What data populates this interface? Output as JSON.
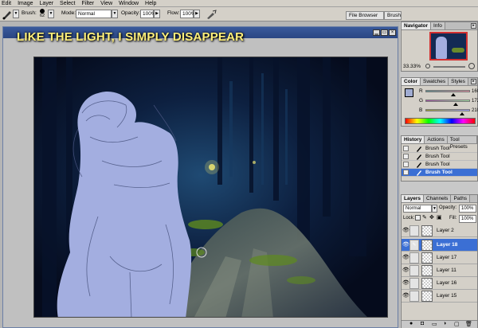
{
  "menu": [
    "Edit",
    "Image",
    "Layer",
    "Select",
    "Filter",
    "View",
    "Window",
    "Help"
  ],
  "options": {
    "brush_label": "Brush:",
    "brush_size": "62",
    "mode_label": "Mode:",
    "mode_value": "Normal",
    "opacity_label": "Opacity:",
    "opacity_value": "100%",
    "flow_label": "Flow:",
    "flow_value": "100%",
    "tabs": [
      "File Browser",
      "Brushe"
    ]
  },
  "caption": "LIKE THE LIGHT, I SIMPLY DISAPPEAR",
  "navigator": {
    "tabs": [
      "Navigator",
      "Info"
    ],
    "zoom": "33.33%"
  },
  "color": {
    "tabs": [
      "Color",
      "Swatches",
      "Styles"
    ],
    "channels": [
      {
        "label": "R",
        "value": "160",
        "fraction": 0.63,
        "gradient": "#5a8f8f,#e08fa0"
      },
      {
        "label": "G",
        "value": "172",
        "fraction": 0.67,
        "gradient": "#a050a0,#a0e0a0"
      },
      {
        "label": "B",
        "value": "210",
        "fraction": 0.82,
        "gradient": "#a0a030,#a0a0ff"
      }
    ],
    "foreground": "#a0acd2",
    "background": "#f2e84a"
  },
  "history": {
    "tabs": [
      "History",
      "Actions",
      "Tool Presets"
    ],
    "items": [
      "Brush Tool",
      "Brush Tool",
      "Brush Tool",
      "Brush Tool"
    ],
    "selected_index": 3
  },
  "layers": {
    "tabs": [
      "Layers",
      "Channels",
      "Paths"
    ],
    "blend_mode": "Normal",
    "opacity_label": "Opacity:",
    "opacity_value": "100%",
    "lock_label": "Lock:",
    "fill_label": "Fill:",
    "fill_value": "100%",
    "items": [
      "Layer 2",
      "Layer 18",
      "Layer 17",
      "Layer 11",
      "Layer 16",
      "Layer 15"
    ],
    "selected_index": 1
  },
  "colors": {
    "selection": "#3b6fd4",
    "figure": "#a3aee0"
  }
}
